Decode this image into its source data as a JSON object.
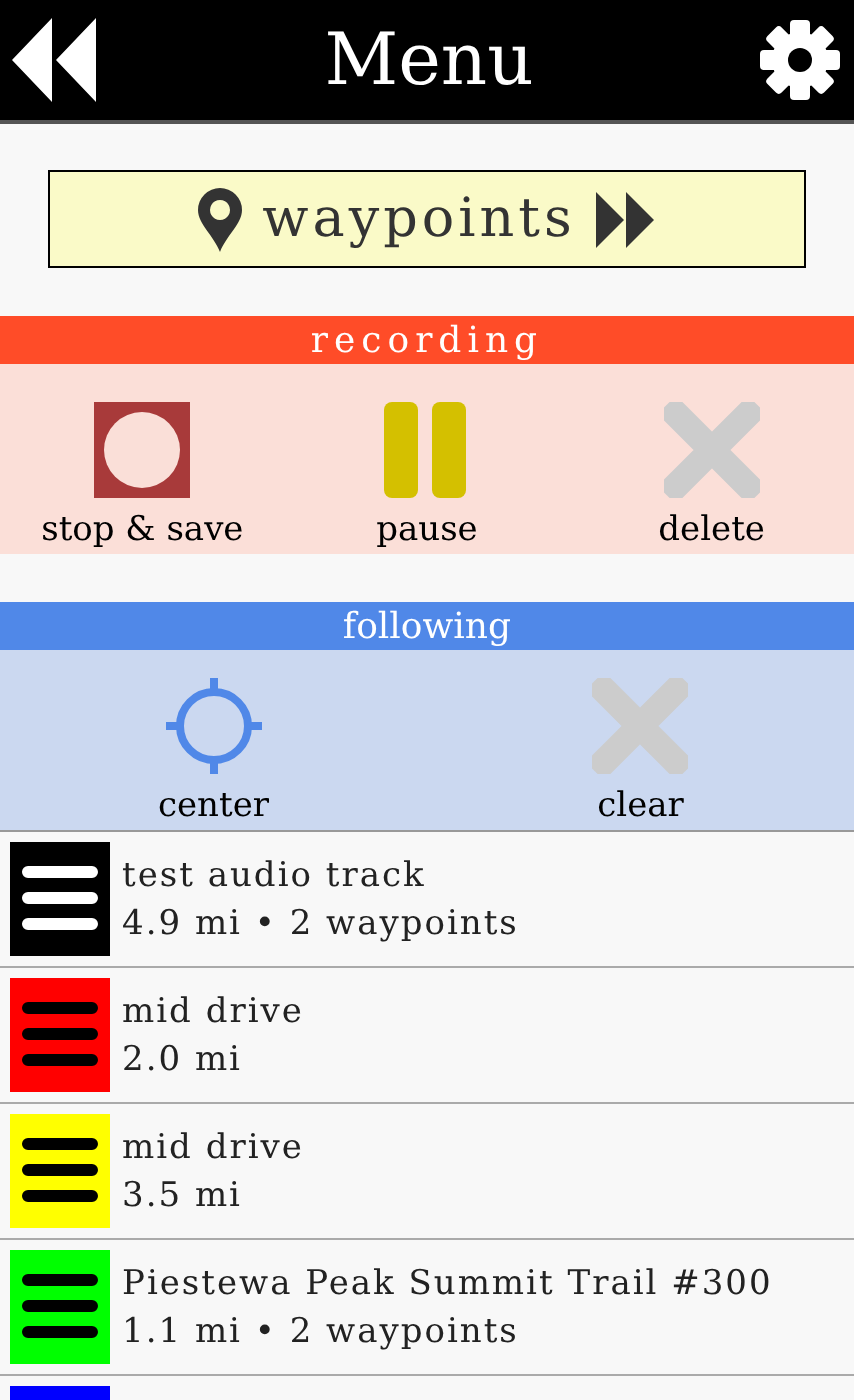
{
  "header": {
    "title": "Menu"
  },
  "waypoints_button": {
    "label": "waypoints"
  },
  "recording": {
    "title": "recording",
    "actions": [
      {
        "kind": "stop",
        "label": "stop & save",
        "disabled": false
      },
      {
        "kind": "pause",
        "label": "pause",
        "disabled": false
      },
      {
        "kind": "delete",
        "label": "delete",
        "disabled": true
      }
    ]
  },
  "following": {
    "title": "following",
    "actions": [
      {
        "kind": "center",
        "label": "center",
        "disabled": false
      },
      {
        "kind": "delete",
        "label": "clear",
        "disabled": true
      }
    ]
  },
  "tracks": [
    {
      "name": "test audio track",
      "details": "4.9 mi • 2 waypoints",
      "color": "#000000"
    },
    {
      "name": "mid drive",
      "details": "2.0 mi",
      "color": "#ff0000"
    },
    {
      "name": "mid drive",
      "details": "3.5 mi",
      "color": "#ffff00"
    },
    {
      "name": "Piestewa Peak Summit Trail #300",
      "details": "1.1 mi • 2 waypoints",
      "color": "#00ff00"
    },
    {
      "color": "#0000ff"
    }
  ]
}
